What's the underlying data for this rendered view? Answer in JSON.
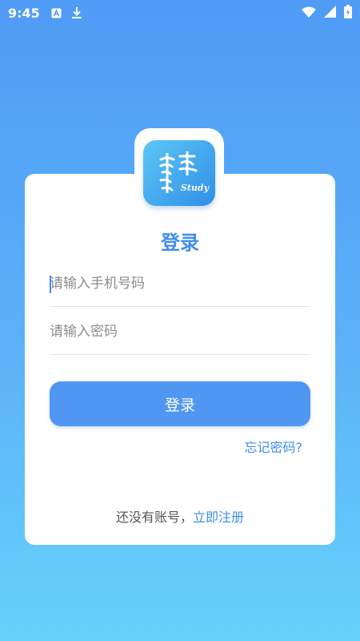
{
  "status_bar": {
    "time": "9:45",
    "icons_left": [
      "font-a-icon",
      "download-icon"
    ],
    "icons_right": [
      "wifi-icon",
      "signal-icon",
      "battery-icon"
    ]
  },
  "logo": {
    "word": "Study",
    "colors": {
      "start": "#5ec6f5",
      "end": "#2f8fe8"
    }
  },
  "login": {
    "title": "登录",
    "phone_placeholder": "请输入手机号码",
    "password_placeholder": "请输入密码",
    "submit_label": "登录",
    "forgot_label": "忘记密码?",
    "register_prompt": "还没有账号，",
    "register_link": "立即注册"
  },
  "colors": {
    "accent": "#3f8ef0",
    "button": "#4f97f3",
    "background_top": "#4f9bf6",
    "background_bottom": "#66d1fb"
  }
}
